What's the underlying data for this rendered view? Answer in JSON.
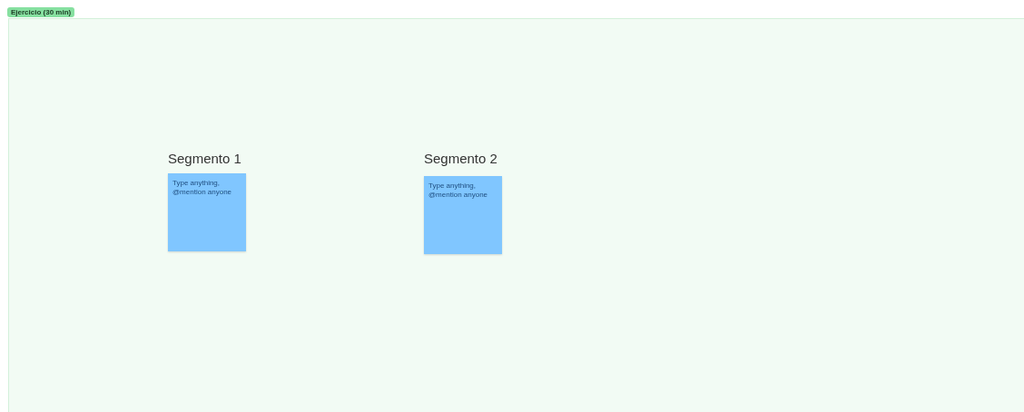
{
  "frame": {
    "label": "Ejercicio (30 min)"
  },
  "sections": [
    {
      "title": "Segmento 1",
      "sticky": {
        "placeholder": "Type anything, @mention anyone"
      }
    },
    {
      "title": "Segmento 2",
      "sticky": {
        "placeholder": "Type anything, @mention anyone"
      }
    }
  ]
}
